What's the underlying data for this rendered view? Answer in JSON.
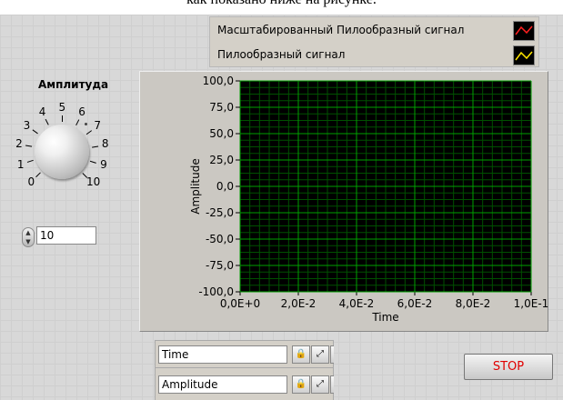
{
  "caption": "как показано ниже на рисунке.",
  "legend": {
    "items": [
      {
        "label": "Масштабированный Пилообразный сигнал",
        "color": "#ff2020"
      },
      {
        "label": "Пилообразный сигнал",
        "color": "#ffe600"
      }
    ]
  },
  "knob": {
    "title": "Амплитуда",
    "scale": [
      "0",
      "1",
      "2",
      "3",
      "4",
      "5",
      "6",
      "7",
      "8",
      "9",
      "10"
    ],
    "value": 10
  },
  "numeric": {
    "value": "10"
  },
  "scales": {
    "x_name": "Time",
    "y_name": "Amplitude"
  },
  "stop": {
    "label": "STOP"
  },
  "chart_data": {
    "type": "line",
    "xlabel": "Time",
    "ylabel": "Amplitude",
    "xlim": [
      0,
      0.1
    ],
    "ylim": [
      -100,
      100
    ],
    "x_ticks": [
      "0,0E+0",
      "2,0E-2",
      "4,0E-2",
      "6,0E-2",
      "8,0E-2",
      "1,0E-1"
    ],
    "y_ticks": [
      "100,0",
      "75,0",
      "50,0",
      "25,0",
      "0,0",
      "-25,0",
      "-50,0",
      "-75,0",
      "-100,0"
    ],
    "grid": true,
    "grid_color": "#00a000",
    "background": "#000000",
    "series": []
  }
}
